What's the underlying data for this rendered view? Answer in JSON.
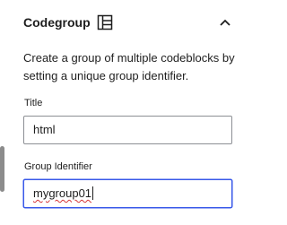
{
  "panel": {
    "title": "Codegroup",
    "title_icon": "layout-icon",
    "collapse_icon": "chevron-up-icon",
    "description": "Create a group of multiple codeblocks by setting a unique group identifier.",
    "fields": {
      "title": {
        "label": "Title",
        "value": "html"
      },
      "group_identifier": {
        "label": "Group Identifier",
        "value": "mygroup01"
      }
    }
  },
  "colors": {
    "focus_border": "#3858e9",
    "input_border": "#8c8f94",
    "spellcheck_underline": "#d63638"
  }
}
